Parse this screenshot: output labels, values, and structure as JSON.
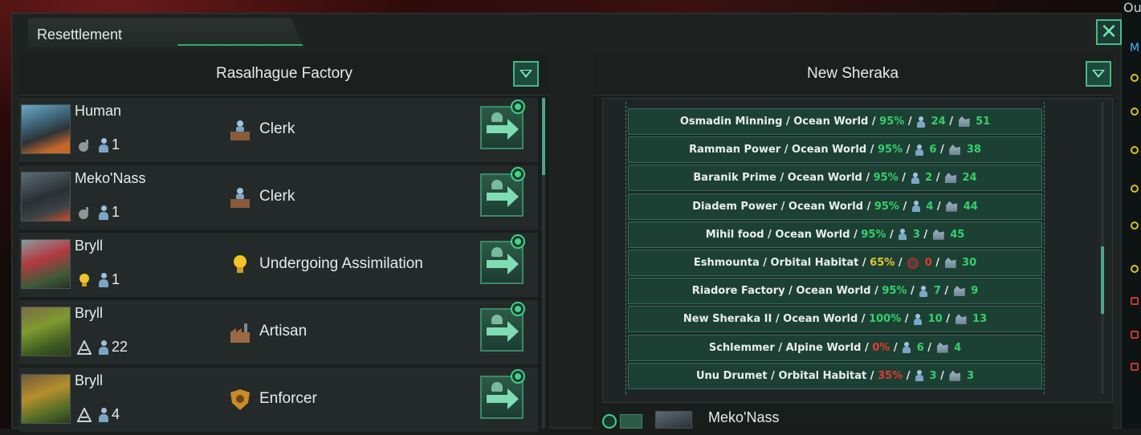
{
  "window": {
    "title": "Resettlement",
    "close_icon": "close-icon"
  },
  "corner_text": "Ou",
  "corner_text_2": "M",
  "source": {
    "planet_name": "Rasalhague Factory",
    "pops": [
      {
        "species": "Human",
        "stat_icon": "bomb-icon",
        "count": "1",
        "job_icon": "clerk-icon",
        "job": "Clerk"
      },
      {
        "species": "Meko'Nass",
        "stat_icon": "bomb-icon",
        "count": "1",
        "job_icon": "clerk-icon",
        "job": "Clerk"
      },
      {
        "species": "Bryll",
        "stat_icon": "lightbulb-icon",
        "count": "1",
        "job_icon": "lightbulb-icon",
        "job": "Undergoing Assimilation"
      },
      {
        "species": "Bryll",
        "stat_icon": "stratum-icon",
        "count": "22",
        "job_icon": "factory-icon",
        "job": "Artisan"
      },
      {
        "species": "Bryll",
        "stat_icon": "stratum-icon",
        "count": "4",
        "job_icon": "shield-icon",
        "job": "Enforcer"
      }
    ]
  },
  "destination": {
    "planet_name": "New Sheraka",
    "planets": [
      {
        "name": "Osmadin Minning",
        "type": "Ocean World",
        "habitability": "95%",
        "hab_status": "green",
        "pop_icon": "pop-icon",
        "pops": "24",
        "housing": "51"
      },
      {
        "name": "Ramman Power",
        "type": "Ocean World",
        "habitability": "95%",
        "hab_status": "green",
        "pop_icon": "pop-icon",
        "pops": "6",
        "housing": "38"
      },
      {
        "name": "Baranik Prime",
        "type": "Ocean World",
        "habitability": "95%",
        "hab_status": "green",
        "pop_icon": "pop-icon",
        "pops": "2",
        "housing": "24"
      },
      {
        "name": "Diadem Power",
        "type": "Ocean World",
        "habitability": "95%",
        "hab_status": "green",
        "pop_icon": "pop-icon",
        "pops": "4",
        "housing": "44"
      },
      {
        "name": "Mihil food",
        "type": "Ocean World",
        "habitability": "95%",
        "hab_status": "green",
        "pop_icon": "pop-icon",
        "pops": "3",
        "housing": "45"
      },
      {
        "name": "Eshmounta",
        "type": "Orbital Habitat",
        "habitability": "65%",
        "hab_status": "yellow",
        "pop_icon": "robot-icon",
        "pops": "0",
        "housing": "30"
      },
      {
        "name": "Riadore Factory",
        "type": "Ocean World",
        "habitability": "95%",
        "hab_status": "green",
        "pop_icon": "pop-icon",
        "pops": "7",
        "housing": "9"
      },
      {
        "name": "New Sheraka II",
        "type": "Ocean World",
        "habitability": "100%",
        "hab_status": "green",
        "pop_icon": "pop-icon",
        "pops": "10",
        "housing": "13"
      },
      {
        "name": "Schlemmer",
        "type": "Alpine World",
        "habitability": "0%",
        "hab_status": "red",
        "pop_icon": "pop-icon",
        "pops": "6",
        "housing": "4"
      },
      {
        "name": "Unu Drumet",
        "type": "Orbital Habitat",
        "habitability": "35%",
        "hab_status": "red",
        "pop_icon": "pop-icon",
        "pops": "3",
        "housing": "3"
      }
    ],
    "preview_species": "Meko'Nass"
  },
  "colors": {
    "accent": "#45b885",
    "hab_green": "#35d16b",
    "hab_yellow": "#e6c535",
    "hab_red": "#e5392c"
  }
}
